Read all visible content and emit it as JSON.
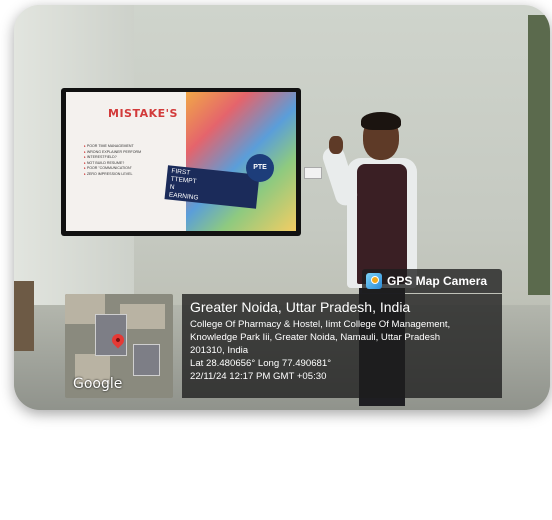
{
  "slide": {
    "title": "MISTAKE'S",
    "bullets": [
      "POOR TIME MANAGEMENT",
      "WRONG EXPLAINER PERFORM",
      "INTERESTFIELD?",
      "NOT BUILD RESUME?",
      "POOR \"COMMUNICATION\"",
      "ZERO IMPRESSION LEVEL"
    ],
    "badge": "PTE",
    "banner_lines": [
      "FIRST",
      "TTEMPT",
      "N",
      "EARNING"
    ]
  },
  "gps": {
    "app_label": "GPS Map Camera",
    "map_brand": "Google",
    "location_title": "Greater Noida, Uttar Pradesh, India",
    "address_line1": "College Of Pharmacy & Hostel, Iimt College Of Management,",
    "address_line2": "Knowledge Park Iii, Greater Noida, Namauli, Uttar Pradesh",
    "address_line3": "201310, India",
    "coords": "Lat 28.480656° Long 77.490681°",
    "datetime": "22/11/24 12:17 PM GMT +05:30"
  },
  "colors": {
    "overlay": "#1e1e1e",
    "pin": "#e53935",
    "slide_title": "#d23a3a"
  }
}
